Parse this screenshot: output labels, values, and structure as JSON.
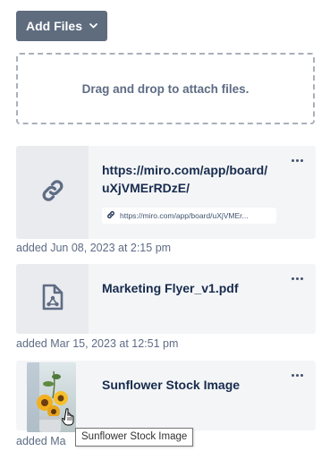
{
  "toolbar": {
    "add_files_label": "Add Files",
    "dropdown_icon": "chevron-down-icon"
  },
  "dropzone": {
    "text": "Drag and drop to attach files."
  },
  "attachments": [
    {
      "icon": "link-icon",
      "title": "https://miro.com/app/board/uXjVMErRDzE/",
      "title_line1": "https://miro.com/app/board/",
      "title_line2": "uXjVMErRDzE/",
      "url_chip": "https://miro.com/app/board/uXjVMEr...",
      "added": "added Jun 08, 2023 at 2:15 pm"
    },
    {
      "icon": "document-icon",
      "title": "Marketing Flyer_v1.pdf",
      "added": "added Mar 15, 2023 at 12:51 pm"
    },
    {
      "icon": "image-thumbnail",
      "title": "Sunflower Stock Image",
      "added": "added Ma"
    }
  ],
  "tooltip": {
    "text": "Sunflower Stock Image"
  },
  "colors": {
    "button": "#5e6c7e",
    "card": "#f4f5f7",
    "text_muted": "#5e6c84"
  }
}
